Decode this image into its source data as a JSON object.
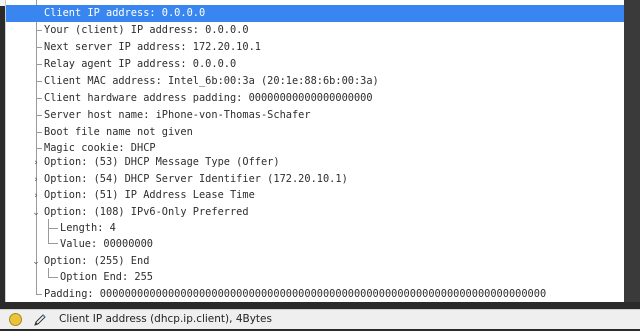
{
  "tree_rows": [
    {
      "text": "Client IP address: 0.0.0.0",
      "selected": true
    },
    {
      "text": "Your (client) IP address: 0.0.0.0"
    },
    {
      "text": "Next server IP address: 172.20.10.1"
    },
    {
      "text": "Relay agent IP address: 0.0.0.0"
    },
    {
      "text": "Client MAC address: Intel_6b:00:3a (20:1e:88:6b:00:3a)"
    },
    {
      "text": "Client hardware address padding: 00000000000000000000"
    },
    {
      "text": "Server host name: iPhone-von-Thomas-Schafer"
    },
    {
      "text": "Boot file name not given"
    },
    {
      "text": "Magic cookie: DHCP"
    },
    {
      "text": "Option: (53) DHCP Message Type (Offer)",
      "expander": "collapsed"
    },
    {
      "text": "Option: (54) DHCP Server Identifier (172.20.10.1)",
      "expander": "collapsed"
    },
    {
      "text": "Option: (51) IP Address Lease Time",
      "expander": "collapsed"
    },
    {
      "text": "Option: (108) IPv6-Only Preferred",
      "expander": "expanded"
    },
    {
      "text": "Length: 4",
      "child": true
    },
    {
      "text": "Value: 00000000",
      "child": true
    },
    {
      "text": "Option: (255) End",
      "expander": "expanded"
    },
    {
      "text": "Option End: 255",
      "child": true
    },
    {
      "text": "Padding: 000000000000000000000000000000000000000000000000000000000000000000000000"
    }
  ],
  "status_bar": {
    "field_info": "Client IP address (dhcp.ip.client), 4Bytes",
    "led_icon": "expert-info-led-icon",
    "edit_icon": "edit-comment-icon",
    "led_color": "#e9c43a"
  },
  "colors": {
    "selection": "#3a86f0"
  }
}
